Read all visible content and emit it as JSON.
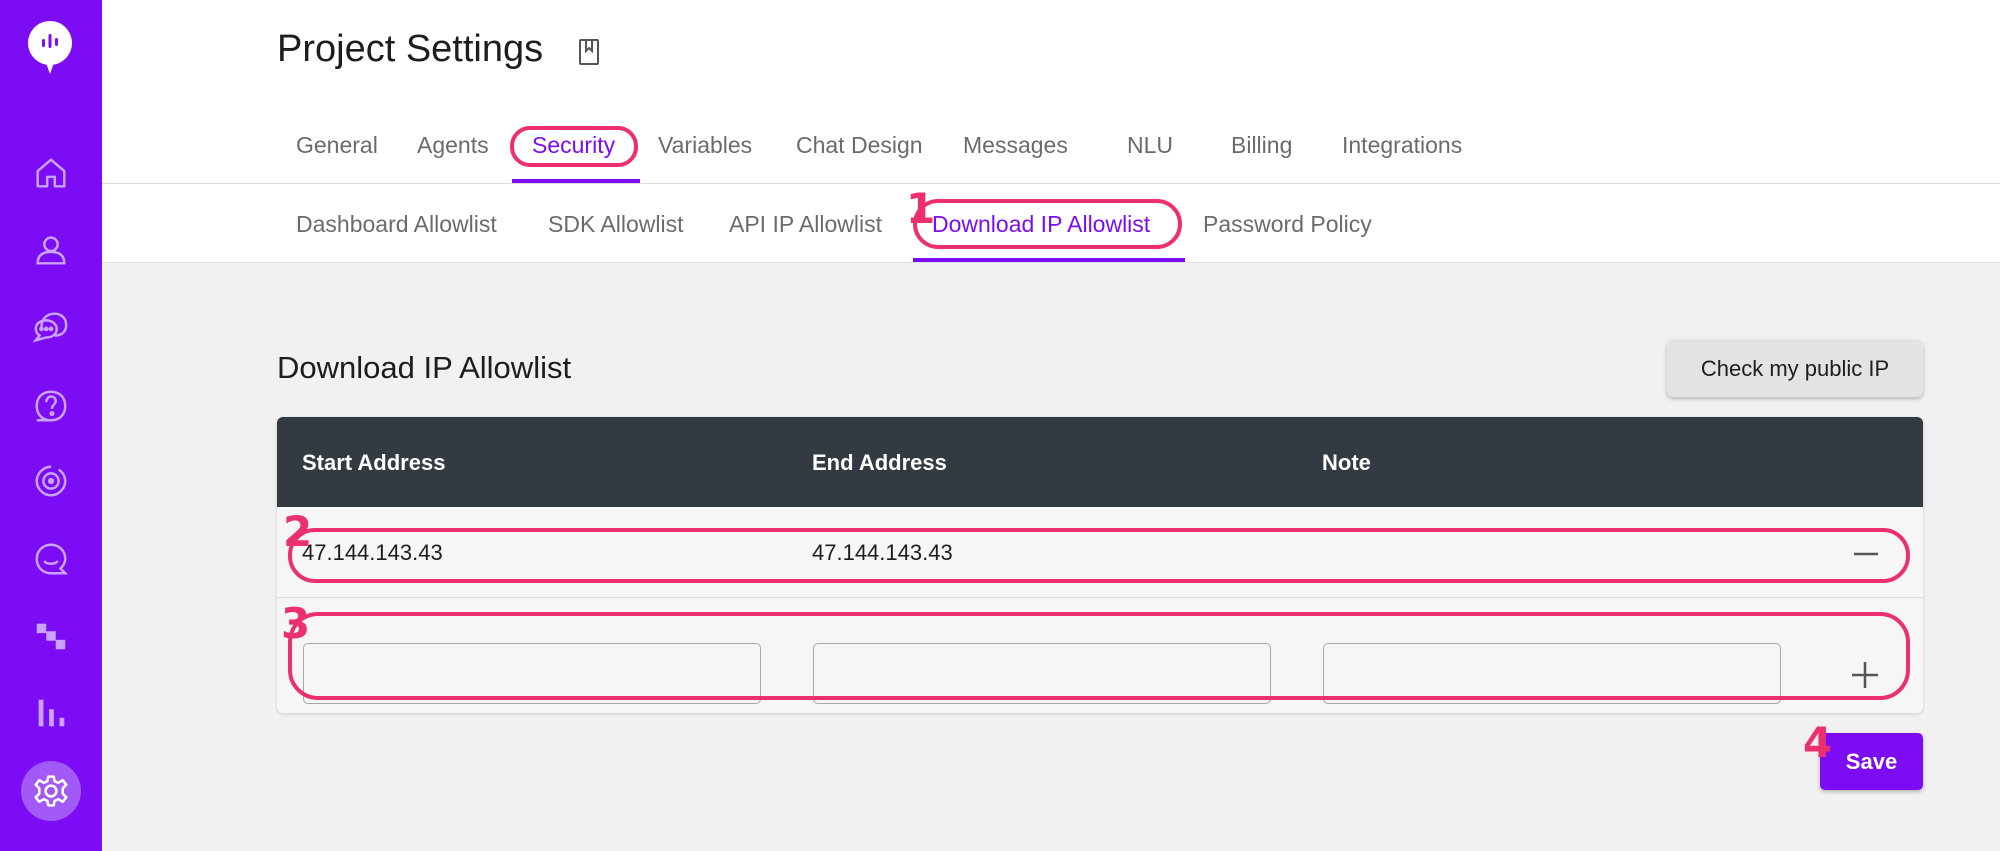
{
  "page": {
    "title": "Project Settings"
  },
  "tabs": [
    "General",
    "Agents",
    "Security",
    "Variables",
    "Chat Design",
    "Messages",
    "NLU",
    "Billing",
    "Integrations"
  ],
  "active_tab": "Security",
  "subtabs": [
    "Dashboard Allowlist",
    "SDK Allowlist",
    "API IP Allowlist",
    "Download IP Allowlist",
    "Password Policy"
  ],
  "active_subtab": "Download IP Allowlist",
  "section": {
    "title": "Download IP Allowlist",
    "check_ip_label": "Check my public IP"
  },
  "table": {
    "columns": [
      "Start Address",
      "End Address",
      "Note"
    ],
    "rows": [
      {
        "start": "47.144.143.43",
        "end": "47.144.143.43",
        "note": ""
      }
    ]
  },
  "save_label": "Save",
  "annotations": [
    "1",
    "2",
    "3",
    "4"
  ],
  "colors": {
    "accent": "#7b0cf3",
    "annotation": "#ec2f6d",
    "table_header": "#343a42"
  }
}
